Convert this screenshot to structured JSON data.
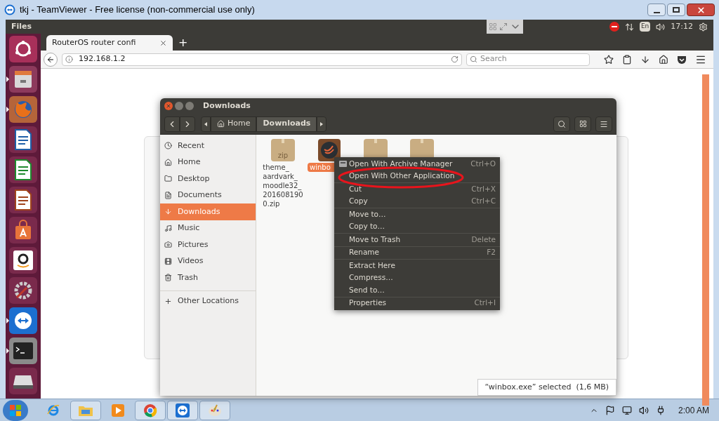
{
  "window": {
    "title": "tkj - TeamViewer - Free license (non-commercial use only)"
  },
  "top_panel": {
    "app_name": "Files",
    "keyboard_layout": "En",
    "clock": "17:12"
  },
  "launcher": [
    {
      "kind": "ubuntu",
      "running": false
    },
    {
      "kind": "files",
      "running": true
    },
    {
      "kind": "firefox",
      "running": true
    },
    {
      "kind": "writer",
      "running": false
    },
    {
      "kind": "calc",
      "running": false
    },
    {
      "kind": "impress",
      "running": false
    },
    {
      "kind": "store",
      "running": false
    },
    {
      "kind": "amazon",
      "running": false
    },
    {
      "kind": "settings",
      "running": false
    },
    {
      "kind": "teamviewer",
      "running": true
    },
    {
      "kind": "terminal",
      "running": true
    },
    {
      "kind": "disk",
      "running": false
    }
  ],
  "browser": {
    "tabs": [
      {
        "label": "RouterOS router confi",
        "selected": true
      }
    ],
    "new_tab": "+",
    "url": "192.168.1.2",
    "search": {
      "placeholder": "Search"
    }
  },
  "files_window": {
    "title": "Downloads",
    "path": [
      {
        "label": "Home",
        "selected": false
      },
      {
        "label": "Downloads",
        "selected": true
      }
    ],
    "sidebar": [
      {
        "label": "Recent",
        "kind": "recent",
        "selected": false
      },
      {
        "label": "Home",
        "kind": "home",
        "selected": false
      },
      {
        "label": "Desktop",
        "kind": "desktop",
        "selected": false
      },
      {
        "label": "Documents",
        "kind": "documents",
        "selected": false
      },
      {
        "label": "Downloads",
        "kind": "downloads",
        "selected": true
      },
      {
        "label": "Music",
        "kind": "music",
        "selected": false
      },
      {
        "label": "Pictures",
        "kind": "pictures",
        "selected": false
      },
      {
        "label": "Videos",
        "kind": "videos",
        "selected": false
      },
      {
        "label": "Trash",
        "kind": "trash",
        "selected": false
      }
    ],
    "other_locations": "Other Locations",
    "files": [
      {
        "kind": "zip",
        "name_lines": [
          "theme_",
          "aardvark_",
          "moodle32_",
          "201608190",
          "0.zip"
        ],
        "badge": "zip",
        "selected": false
      },
      {
        "kind": "app",
        "name_lines": [
          "winbo"
        ],
        "selected": true
      },
      {
        "kind": "box",
        "selected": false
      },
      {
        "kind": "box",
        "selected": false
      }
    ],
    "status": "“winbox.exe” selected  (1,6 MB)"
  },
  "context_menu": [
    [
      {
        "label": "Open With Archive Manager",
        "shortcut": "Ctrl+O",
        "icon": true
      },
      {
        "label": "Open With Other Application",
        "highlighted": true
      }
    ],
    [
      {
        "label": "Cut",
        "shortcut": "Ctrl+X"
      },
      {
        "label": "Copy",
        "shortcut": "Ctrl+C"
      }
    ],
    [
      {
        "label": "Move to…"
      },
      {
        "label": "Copy to…"
      }
    ],
    [
      {
        "label": "Move to Trash",
        "shortcut": "Delete"
      }
    ],
    [
      {
        "label": "Rename",
        "shortcut": "F2"
      }
    ],
    [
      {
        "label": "Extract Here"
      },
      {
        "label": "Compress…"
      },
      {
        "label": "Send to…"
      }
    ],
    [
      {
        "label": "Properties",
        "shortcut": "Ctrl+I"
      }
    ]
  ],
  "taskbar": {
    "apps": [
      {
        "kind": "ie",
        "pinned_open": false
      },
      {
        "kind": "explorer",
        "pinned_open": true
      },
      {
        "kind": "media",
        "pinned_open": false
      },
      {
        "kind": "chrome",
        "pinned_open": true
      },
      {
        "kind": "teamviewer",
        "pinned_open": true
      },
      {
        "kind": "paint",
        "pinned_open": true
      }
    ],
    "clock": "2:00 AM"
  }
}
